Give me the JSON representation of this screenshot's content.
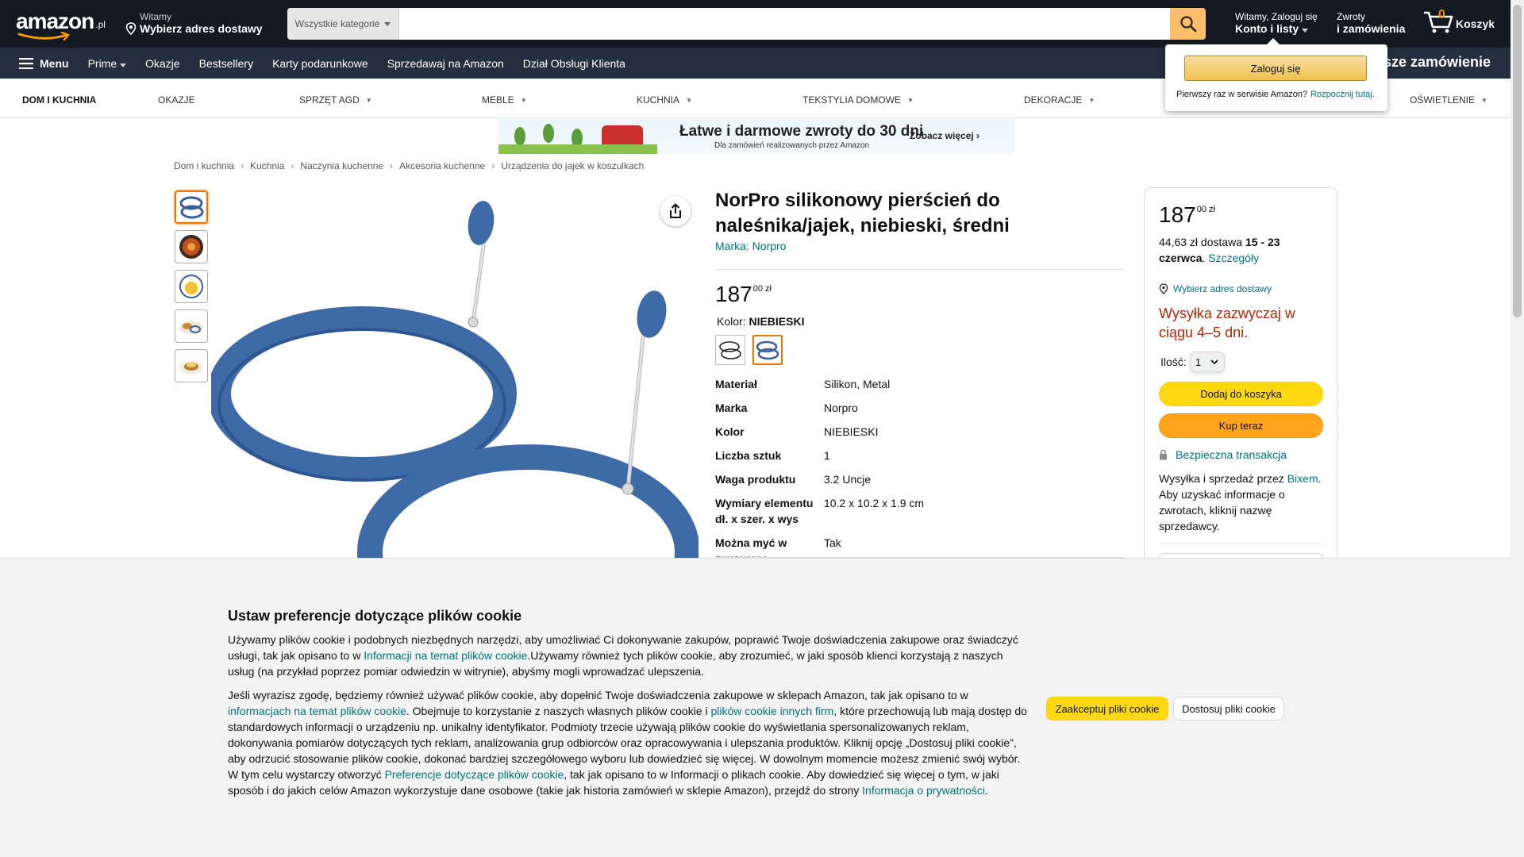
{
  "header": {
    "logo_text": "amazon",
    "logo_tld": ".pl",
    "deliver_line1": "Witamy",
    "deliver_line2": "Wybierz adres dostawy",
    "search_category": "Wszystkie kategorie",
    "search_value": "",
    "account_line1": "Witamy, Zaloguj się",
    "account_line2": "Konto i listy",
    "returns_line1": "Zwroty",
    "returns_line2": "i zamówienia",
    "cart_count": "0",
    "cart_label": "Koszyk"
  },
  "subnav": {
    "menu_label": "Menu",
    "items": [
      "Prime",
      "Okazje",
      "Bestsellery",
      "Karty podarunkowe",
      "Sprzedawaj na Amazon",
      "Dział Obsługi Klienta"
    ],
    "promo": "Darmowa dostawa na pierwsze zamówienie"
  },
  "category_bar": {
    "items": [
      "DOM I KUCHNIA",
      "OKAZJE",
      "SPRZĘT AGD",
      "MEBLE",
      "KUCHNIA",
      "TEKSTYLIA DOMOWE",
      "DEKORACJE",
      "OŚWIETLENIE"
    ]
  },
  "banner": {
    "title": "Łatwe i darmowe zwroty do 30 dni",
    "subtitle": "Dla zamówień realizowanych przez Amazon",
    "cta": "Zobacz więcej ›"
  },
  "breadcrumb": [
    "Dom i kuchnia",
    "Kuchnia",
    "Naczynia kuchenne",
    "Akcesoria kuchenne",
    "Urządzenia do jajek w koszulkach"
  ],
  "product": {
    "title": "NorPro silikonowy pierścień do naleśnika/jajek, niebieski, średni",
    "brand_link": "Marka: Norpro",
    "price_whole": "187",
    "price_frac": "00 zł",
    "color_label": "Kolor:",
    "color_value": "NIEBIESKI",
    "specs": [
      {
        "k": "Materiał",
        "v": "Silikon, Metal"
      },
      {
        "k": "Marka",
        "v": "Norpro"
      },
      {
        "k": "Kolor",
        "v": "NIEBIESKI"
      },
      {
        "k": "Liczba sztuk",
        "v": "1"
      },
      {
        "k": "Waga produktu",
        "v": "3.2 Uncje"
      },
      {
        "k": "Wymiary elementu dł. x szer. x wys",
        "v": "10.2 x 10.2 x 1.9 cm"
      },
      {
        "k": "Można myć w zmywarce",
        "v": "Tak"
      }
    ],
    "accent_color": "#3b5f9a"
  },
  "buybox": {
    "price_whole": "187",
    "price_frac": "00 zł",
    "shipping_text": "44,63 zł dostawa",
    "shipping_date": "15 - 23 czerwca",
    "details_link": "Szczegóły",
    "address_link": "Wybierz adres dostawy",
    "stock": "Wysyłka zazwyczaj w ciągu 4–5 dni.",
    "qty_label": "Ilość:",
    "qty_value": "1",
    "add_to_cart": "Dodaj do koszyka",
    "buy_now": "Kup teraz",
    "secure": "Bezpieczna transakcja",
    "sold_pre": "Wysyłka i sprzedaż przez",
    "seller": "Bixem",
    "sold_post": ". Aby uzyskać informacje o zwrotach, kliknij nazwę sprzedawcy."
  },
  "flyout": {
    "signin": "Zaloguj się",
    "new_customer": "Pierwszy raz w serwisie Amazon?",
    "start_link": "Rozpocznij tutaj."
  },
  "cookie": {
    "title": "Ustaw preferencje dotyczące plików cookie",
    "p1_a": "Używamy plików cookie i podobnych niezbędnych narzędzi, aby umożliwiać Ci dokonywanie zakupów, poprawić Twoje doświadczenia zakupowe oraz świadczyć usługi, tak jak opisano to w ",
    "p1_link": "Informacji na temat plików cookie",
    "p1_b": ".Używamy również tych plików cookie, aby zrozumieć, w jaki sposób klienci korzystają z naszych usług (na przykład poprzez pomiar odwiedzin w witrynie), abyśmy mogli wprowadzać ulepszenia.",
    "p2_a": "Jeśli wyrazisz zgodę, będziemy również używać plików cookie, aby dopełnić Twoje doświadczenia zakupowe w sklepach Amazon, tak jak opisano to w ",
    "p2_link1": "informacjach na temat plików cookie",
    "p2_b": ". Obejmuje to korzystanie z naszych własnych plików cookie i ",
    "p2_link2": "plików cookie innych firm",
    "p2_c": ", które przechowują lub mają dostęp do standardowych informacji o urządzeniu np. unikalny identyfikator. Podmioty trzecie używają plików cookie do wyświetlania spersonalizowanych reklam, dokonywania pomiarów dotyczących tych reklam, analizowania grup odbiorców oraz opracowywania i ulepszania produktów. Kliknij opcję „Dostosuj pliki cookie”, aby odrzucić stosowanie plików cookie, dokonać bardziej szczegółowego wyboru lub dowiedzieć się więcej. W dowolnym momencie możesz zmienić swój wybór. W tym celu wystarczy otworzyć ",
    "p2_link3": "Preferencje dotyczące plików cookie",
    "p2_d": ", tak jak opisano to w Informacji o plikach cookie. Aby dowiedzieć się więcej o tym, w jaki sposób i do jakich celów Amazon wykorzystuje dane osobowe (takie jak historia zamówień w sklepie Amazon), przejdź do strony ",
    "p2_link4": "Informacja o prywatności",
    "p2_e": ".",
    "accept": "Zaakceptuj pliki cookie",
    "customize": "Dostosuj pliki cookie"
  }
}
